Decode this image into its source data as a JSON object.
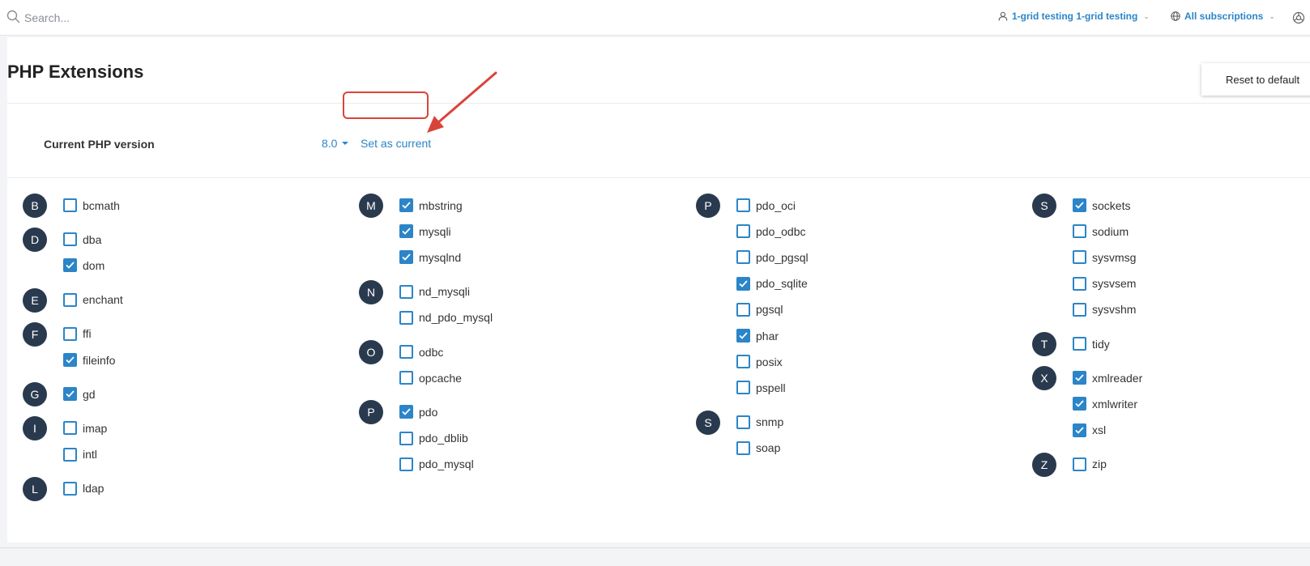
{
  "search": {
    "placeholder": "Search..."
  },
  "header": {
    "user_label": "1-grid testing 1-grid testing",
    "subscriptions_label": "All subscriptions"
  },
  "page": {
    "title": "PHP Extensions",
    "reset_label": "Reset to default",
    "version_label": "Current PHP version",
    "version_value": "8.0",
    "set_current_label": "Set as current"
  },
  "colors": {
    "accent": "#2b85c8",
    "badge": "#2a3a4e",
    "highlight": "#d9443a"
  },
  "columns": [
    {
      "groups": [
        {
          "letter": "B",
          "items": [
            {
              "name": "bcmath",
              "checked": false
            }
          ]
        },
        {
          "letter": "D",
          "items": [
            {
              "name": "dba",
              "checked": false
            },
            {
              "name": "dom",
              "checked": true
            }
          ]
        },
        {
          "letter": "E",
          "items": [
            {
              "name": "enchant",
              "checked": false
            }
          ]
        },
        {
          "letter": "F",
          "items": [
            {
              "name": "ffi",
              "checked": false
            },
            {
              "name": "fileinfo",
              "checked": true
            }
          ]
        },
        {
          "letter": "G",
          "items": [
            {
              "name": "gd",
              "checked": true
            }
          ]
        },
        {
          "letter": "I",
          "items": [
            {
              "name": "imap",
              "checked": false
            },
            {
              "name": "intl",
              "checked": false
            }
          ]
        },
        {
          "letter": "L",
          "items": [
            {
              "name": "ldap",
              "checked": false
            }
          ]
        }
      ]
    },
    {
      "groups": [
        {
          "letter": "M",
          "items": [
            {
              "name": "mbstring",
              "checked": true
            },
            {
              "name": "mysqli",
              "checked": true
            },
            {
              "name": "mysqlnd",
              "checked": true
            }
          ]
        },
        {
          "letter": "N",
          "items": [
            {
              "name": "nd_mysqli",
              "checked": false
            },
            {
              "name": "nd_pdo_mysql",
              "checked": false
            }
          ]
        },
        {
          "letter": "O",
          "items": [
            {
              "name": "odbc",
              "checked": false
            },
            {
              "name": "opcache",
              "checked": false
            }
          ]
        },
        {
          "letter": "P",
          "items": [
            {
              "name": "pdo",
              "checked": true
            },
            {
              "name": "pdo_dblib",
              "checked": false
            },
            {
              "name": "pdo_mysql",
              "checked": false
            }
          ]
        }
      ]
    },
    {
      "groups": [
        {
          "letter": "P",
          "items": [
            {
              "name": "pdo_oci",
              "checked": false
            },
            {
              "name": "pdo_odbc",
              "checked": false
            },
            {
              "name": "pdo_pgsql",
              "checked": false
            },
            {
              "name": "pdo_sqlite",
              "checked": true
            },
            {
              "name": "pgsql",
              "checked": false
            },
            {
              "name": "phar",
              "checked": true
            },
            {
              "name": "posix",
              "checked": false
            },
            {
              "name": "pspell",
              "checked": false
            }
          ]
        },
        {
          "letter": "S",
          "items": [
            {
              "name": "snmp",
              "checked": false
            },
            {
              "name": "soap",
              "checked": false
            }
          ]
        }
      ]
    },
    {
      "groups": [
        {
          "letter": "S",
          "items": [
            {
              "name": "sockets",
              "checked": true
            },
            {
              "name": "sodium",
              "checked": false
            },
            {
              "name": "sysvmsg",
              "checked": false
            },
            {
              "name": "sysvsem",
              "checked": false
            },
            {
              "name": "sysvshm",
              "checked": false
            }
          ]
        },
        {
          "letter": "T",
          "items": [
            {
              "name": "tidy",
              "checked": false
            }
          ]
        },
        {
          "letter": "X",
          "items": [
            {
              "name": "xmlreader",
              "checked": true
            },
            {
              "name": "xmlwriter",
              "checked": true
            },
            {
              "name": "xsl",
              "checked": true
            }
          ]
        },
        {
          "letter": "Z",
          "items": [
            {
              "name": "zip",
              "checked": false
            }
          ]
        }
      ]
    }
  ]
}
